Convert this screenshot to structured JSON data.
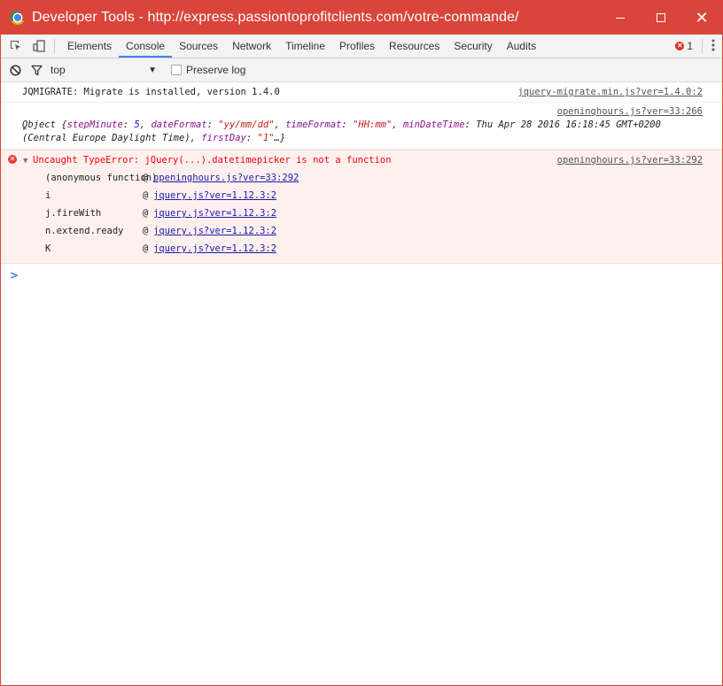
{
  "window": {
    "title": "Developer Tools - http://express.passiontoprofitclients.com/votre-commande/",
    "controls": {
      "minimize": "—",
      "maximize": "☐",
      "close": "✕"
    }
  },
  "toolbar": {
    "inspect_icon": "inspect-element-icon",
    "device_icon": "device-mode-icon",
    "tabs": [
      {
        "label": "Elements"
      },
      {
        "label": "Console"
      },
      {
        "label": "Sources"
      },
      {
        "label": "Network"
      },
      {
        "label": "Timeline"
      },
      {
        "label": "Profiles"
      },
      {
        "label": "Resources"
      },
      {
        "label": "Security"
      },
      {
        "label": "Audits"
      }
    ],
    "active_tab": "Console",
    "error_count": "1"
  },
  "filterbar": {
    "context": "top",
    "preserve_log_label": "Preserve log",
    "preserve_log_checked": false
  },
  "console": {
    "messages": [
      {
        "text": "JQMIGRATE: Migrate is installed, version 1.4.0",
        "source": "jquery-migrate.min.js?ver=1.4.0:2"
      },
      {
        "source": "openinghours.js?ver=33:266",
        "object_prefix": "Object {",
        "p1_key": "stepMinute",
        "p1_val": "5",
        "p2_key": "dateFormat",
        "p2_val": "\"yy/mm/dd\"",
        "p3_key": "timeFormat",
        "p3_val": "\"HH:mm\"",
        "p4_key": "minDateTime",
        "p4_val": "Thu Apr 28 2016 16:18:45 GMT+0200",
        "line2_prefix": "(Central Europe Daylight Time),",
        "p5_key": "firstDay",
        "p5_val": "\"1\"",
        "object_suffix": "…}"
      },
      {
        "text": "Uncaught TypeError: jQuery(...).datetimepicker is not a function",
        "source": "openinghours.js?ver=33:292",
        "stack": [
          {
            "fn": "(anonymous function)",
            "link": "openinghours.js?ver=33:292"
          },
          {
            "fn": "i",
            "link": "jquery.js?ver=1.12.3:2"
          },
          {
            "fn": "j.fireWith",
            "link": "jquery.js?ver=1.12.3:2"
          },
          {
            "fn": "n.extend.ready",
            "link": "jquery.js?ver=1.12.3:2"
          },
          {
            "fn": "K",
            "link": "jquery.js?ver=1.12.3:2"
          }
        ]
      }
    ],
    "prompt_symbol": ">"
  },
  "colors": {
    "titlebar": "#d9453b",
    "active_tab_underline": "#3e82f7",
    "error_text": "#ff0000",
    "error_bg": "#fff0f0",
    "link": "#1a1aa6"
  }
}
